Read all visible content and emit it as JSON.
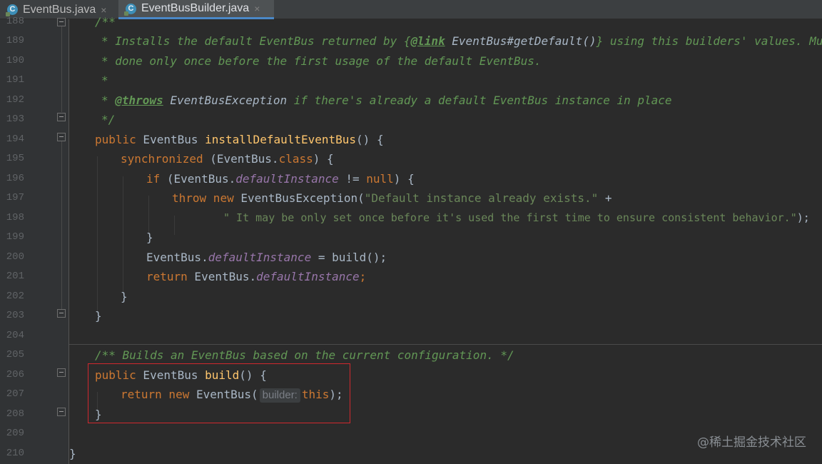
{
  "tabs": [
    {
      "label": "EventBus.java",
      "icon": "java-class-icon",
      "active": false
    },
    {
      "label": "EventBusBuilder.java",
      "icon": "java-class-icon",
      "active": true
    }
  ],
  "line_numbers": [
    "188",
    "189",
    "190",
    "191",
    "192",
    "193",
    "194",
    "195",
    "196",
    "197",
    "198",
    "199",
    "200",
    "201",
    "202",
    "203",
    "204",
    "205",
    "206",
    "207",
    "208",
    "209",
    "210"
  ],
  "code": {
    "l188": "/**",
    "l189_a": "* Installs the default EventBus returned by ",
    "l189_b": "{",
    "l189_c": "@link",
    "l189_d": " EventBus#getDefault()",
    "l189_e": "} using this builders' values. Must be",
    "l190": "* done only once before the first usage of the default EventBus.",
    "l191": "*",
    "l192_a": "* ",
    "l192_b": "@throws",
    "l192_c": " EventBusException",
    "l192_d": " if there's already a default EventBus instance in place",
    "l193": "*/",
    "l194_kw": "public",
    "l194_type": " EventBus ",
    "l194_fn": "installDefaultEventBus",
    "l194_rest": "() {",
    "l195_kw": "synchronized",
    "l195_a": " (EventBus.",
    "l195_cls": "class",
    "l195_b": ") {",
    "l196_kw": "if",
    "l196_a": " (EventBus.",
    "l196_sf": "defaultInstance",
    "l196_b": " != ",
    "l196_null": "null",
    "l196_c": ") {",
    "l197_kw1": "throw",
    "l197_kw2": " new",
    "l197_a": " EventBusException(",
    "l197_str": "\"Default instance already exists.\"",
    "l197_b": " +",
    "l198_str": "\" It may be only set once before it's used the first time to ensure consistent behavior.\"",
    "l198_b": ");",
    "l199": "}",
    "l200_a": "EventBus.",
    "l200_sf": "defaultInstance",
    "l200_b": " = build();",
    "l201_kw": "return",
    "l201_a": " EventBus.",
    "l201_sf": "defaultInstance",
    "l201_b": ";",
    "l202": "}",
    "l203": "}",
    "l205": "/** Builds an EventBus based on the current configuration. */",
    "l206_kw": "public",
    "l206_type": " EventBus ",
    "l206_fn": "build",
    "l206_rest": "() {",
    "l207_kw1": "return",
    "l207_kw2": " new",
    "l207_a": " EventBus(",
    "l207_hint": "builder:",
    "l207_this": "this",
    "l207_b": ");",
    "l208": "}",
    "l210": "}"
  },
  "watermark": "@稀土掘金技术社区",
  "colors": {
    "background": "#2b2b2b",
    "keyword": "#cc7832",
    "doc_comment": "#629755",
    "function": "#ffc66d",
    "static_field": "#9876aa",
    "string": "#6a8759",
    "highlight_box": "#d0282e"
  }
}
